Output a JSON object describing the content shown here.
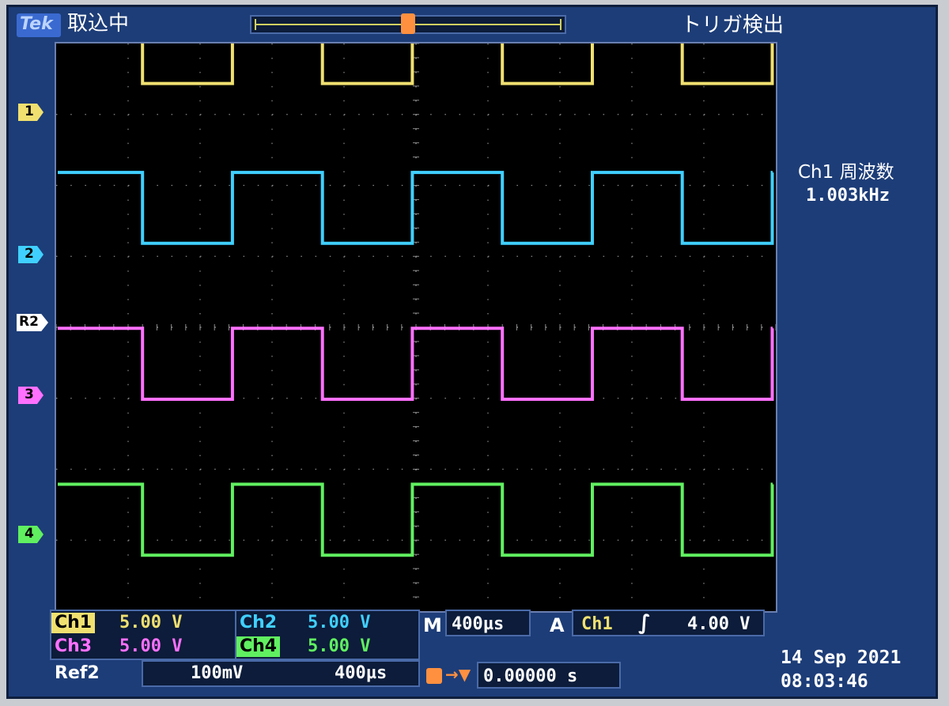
{
  "header": {
    "brand": "Tek",
    "acq_status": "取込中",
    "trigger_status": "トリガ検出"
  },
  "markers": {
    "trigger_pos": "T",
    "ch1": "1",
    "ch2": "2",
    "ref2": "R2",
    "ch3": "3",
    "ch4": "4"
  },
  "measurement": {
    "label": "Ch1 周波数",
    "value": "1.003kHz"
  },
  "channels": [
    {
      "name": "Ch1",
      "scale": "5.00 V",
      "color": "#f0e070"
    },
    {
      "name": "Ch2",
      "scale": "5.00 V",
      "color": "#40d0ff"
    },
    {
      "name": "Ch3",
      "scale": "5.00 V",
      "color": "#ff70ff"
    },
    {
      "name": "Ch4",
      "scale": "5.00 V",
      "color": "#60f060"
    }
  ],
  "ref2": {
    "name": "Ref2",
    "volts": "100mV",
    "time": "400µs"
  },
  "timebase": {
    "label": "M",
    "value": "400µs"
  },
  "trigger": {
    "label": "A",
    "source": "Ch1",
    "level": "4.00 V"
  },
  "position": {
    "icon_text": "T→▼",
    "value": "0.00000 s"
  },
  "datetime": {
    "date": "14 Sep  2021",
    "time": "08:03:46"
  },
  "colors": {
    "bezel": "#1d3d78",
    "grid_bg": "#000000",
    "grid_dots": "#8a8a8a",
    "trigger_marker": "#ff9040",
    "ref2": "#ffffff"
  },
  "traces": {
    "period_div": 2.5,
    "high_frac": 0.5,
    "amplitude_div": 1.0,
    "offsets": [
      {
        "channel": "Ch1",
        "first_edge_div": 1.2,
        "low_level_div": 1.0
      },
      {
        "channel": "Ch2",
        "first_edge_div": 1.2,
        "low_level_div": 5.0
      },
      {
        "channel": "Ch3",
        "first_edge_div": 1.2,
        "low_level_div": 8.9
      },
      {
        "channel": "Ch4",
        "first_edge_div": 1.2,
        "low_level_div": 12.8
      }
    ]
  }
}
